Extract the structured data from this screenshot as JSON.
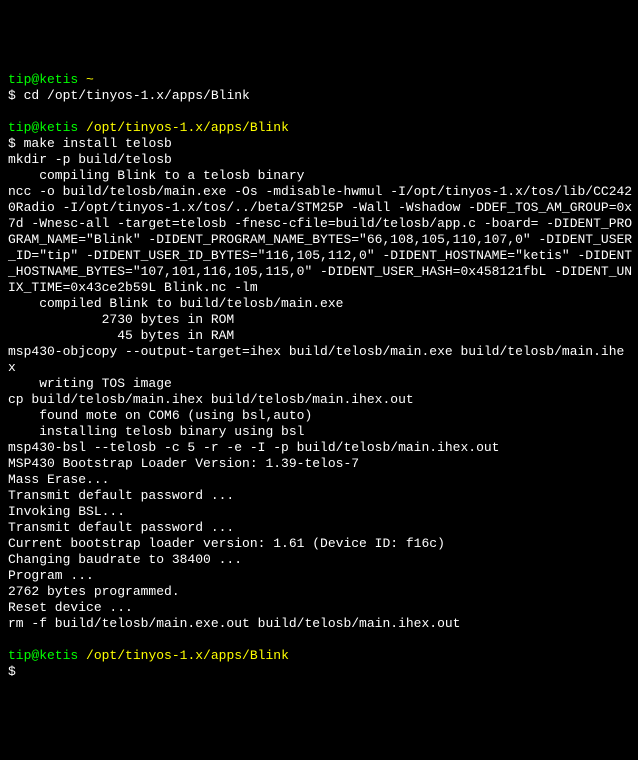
{
  "prompt1": {
    "user": "tip@ketis",
    "path": "~",
    "symbol": "$",
    "cmd": "cd /opt/tinyos-1.x/apps/Blink"
  },
  "prompt2": {
    "user": "tip@ketis",
    "path": "/opt/tinyos-1.x/apps/Blink",
    "symbol": "$",
    "cmd": "make install telosb"
  },
  "output": [
    "mkdir -p build/telosb",
    "    compiling Blink to a telosb binary",
    "ncc -o build/telosb/main.exe -Os -mdisable-hwmul -I/opt/tinyos-1.x/tos/lib/CC242",
    "0Radio -I/opt/tinyos-1.x/tos/../beta/STM25P -Wall -Wshadow -DDEF_TOS_AM_GROUP=0x",
    "7d -Wnesc-all -target=telosb -fnesc-cfile=build/telosb/app.c -board= -DIDENT_PRO",
    "GRAM_NAME=\"Blink\" -DIDENT_PROGRAM_NAME_BYTES=\"66,108,105,110,107,0\" -DIDENT_USER",
    "_ID=\"tip\" -DIDENT_USER_ID_BYTES=\"116,105,112,0\" -DIDENT_HOSTNAME=\"ketis\" -DIDENT",
    "_HOSTNAME_BYTES=\"107,101,116,105,115,0\" -DIDENT_USER_HASH=0x458121fbL -DIDENT_UN",
    "IX_TIME=0x43ce2b59L Blink.nc -lm",
    "    compiled Blink to build/telosb/main.exe",
    "            2730 bytes in ROM",
    "              45 bytes in RAM",
    "msp430-objcopy --output-target=ihex build/telosb/main.exe build/telosb/main.ihe",
    "x",
    "    writing TOS image",
    "cp build/telosb/main.ihex build/telosb/main.ihex.out",
    "    found mote on COM6 (using bsl,auto)",
    "    installing telosb binary using bsl",
    "msp430-bsl --telosb -c 5 -r -e -I -p build/telosb/main.ihex.out",
    "MSP430 Bootstrap Loader Version: 1.39-telos-7",
    "Mass Erase...",
    "Transmit default password ...",
    "Invoking BSL...",
    "Transmit default password ...",
    "Current bootstrap loader version: 1.61 (Device ID: f16c)",
    "Changing baudrate to 38400 ...",
    "Program ...",
    "2762 bytes programmed.",
    "Reset device ...",
    "rm -f build/telosb/main.exe.out build/telosb/main.ihex.out"
  ],
  "prompt3": {
    "user": "tip@ketis",
    "path": "/opt/tinyos-1.x/apps/Blink",
    "symbol": "$",
    "cmd": ""
  }
}
